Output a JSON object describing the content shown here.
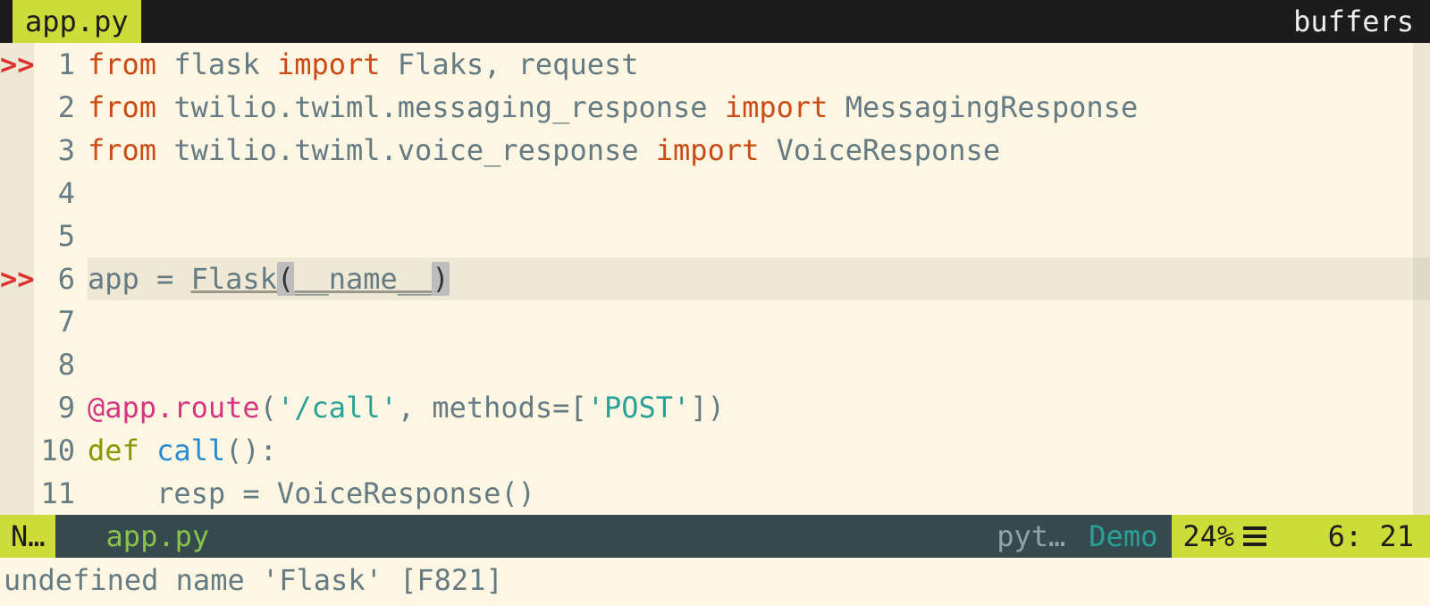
{
  "tabbar": {
    "tab_label": "app.py",
    "buffers_label": "buffers"
  },
  "gutter": {
    "error_marker": ">>"
  },
  "lines": [
    {
      "n": 1,
      "marker": true,
      "tokens": [
        {
          "t": "from ",
          "c": "kw-from"
        },
        {
          "t": "flask ",
          "c": "id"
        },
        {
          "t": "import ",
          "c": "kw-import"
        },
        {
          "t": "Flaks, request",
          "c": "id"
        }
      ]
    },
    {
      "n": 2,
      "marker": false,
      "tokens": [
        {
          "t": "from ",
          "c": "kw-from"
        },
        {
          "t": "twilio.twiml.messaging_response ",
          "c": "id"
        },
        {
          "t": "import ",
          "c": "kw-import"
        },
        {
          "t": "MessagingResponse",
          "c": "id"
        }
      ]
    },
    {
      "n": 3,
      "marker": false,
      "tokens": [
        {
          "t": "from ",
          "c": "kw-from"
        },
        {
          "t": "twilio.twiml.voice_response ",
          "c": "id"
        },
        {
          "t": "import ",
          "c": "kw-import"
        },
        {
          "t": "VoiceResponse",
          "c": "id"
        }
      ]
    },
    {
      "n": 4,
      "marker": false,
      "tokens": [
        {
          "t": " ",
          "c": "id"
        }
      ]
    },
    {
      "n": 5,
      "marker": false,
      "tokens": [
        {
          "t": " ",
          "c": "id"
        }
      ]
    },
    {
      "n": 6,
      "marker": true,
      "current": true,
      "tokens": [
        {
          "t": "app = ",
          "c": "id"
        },
        {
          "t": "Flask",
          "c": "id underline"
        },
        {
          "t": "(",
          "c": "bracket-match"
        },
        {
          "t": "__name__",
          "c": "id underline"
        },
        {
          "t": ")",
          "c": "bracket-match"
        }
      ]
    },
    {
      "n": 7,
      "marker": false,
      "tokens": [
        {
          "t": " ",
          "c": "id"
        }
      ]
    },
    {
      "n": 8,
      "marker": false,
      "tokens": [
        {
          "t": " ",
          "c": "id"
        }
      ]
    },
    {
      "n": 9,
      "marker": false,
      "tokens": [
        {
          "t": "@app.route",
          "c": "at"
        },
        {
          "t": "(",
          "c": "id"
        },
        {
          "t": "'/call'",
          "c": "string"
        },
        {
          "t": ", methods=[",
          "c": "id"
        },
        {
          "t": "'POST'",
          "c": "string"
        },
        {
          "t": "])",
          "c": "id"
        }
      ]
    },
    {
      "n": 10,
      "marker": false,
      "tokens": [
        {
          "t": "def ",
          "c": "def"
        },
        {
          "t": "call",
          "c": "name"
        },
        {
          "t": "():",
          "c": "id"
        }
      ]
    },
    {
      "n": 11,
      "marker": false,
      "tokens": [
        {
          "t": "    resp = VoiceResponse()",
          "c": "id"
        }
      ]
    }
  ],
  "status": {
    "mode": "N…",
    "file": "app.py",
    "filetype": "pyt…",
    "branch": "Demo",
    "percent": "24%",
    "position": "6: 21"
  },
  "message": "undefined name 'Flask' [F821]"
}
